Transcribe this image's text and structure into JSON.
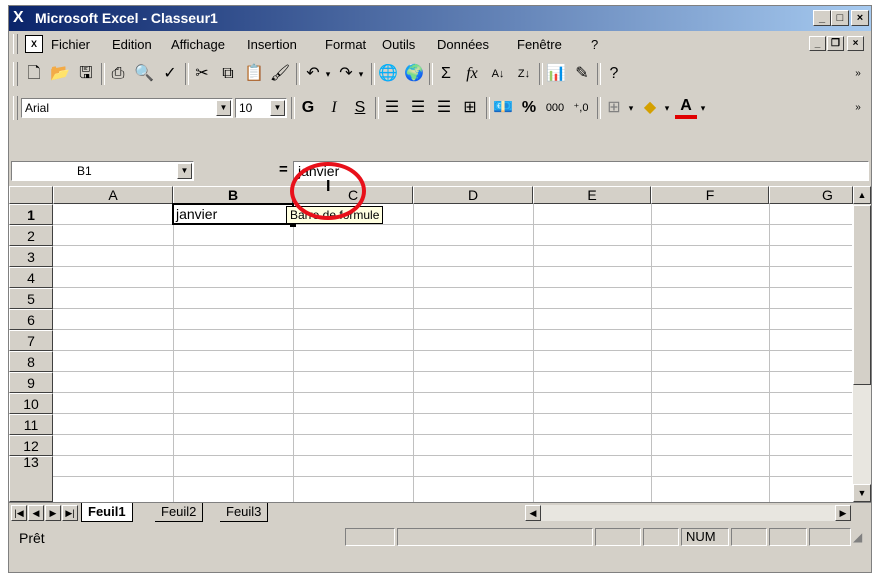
{
  "window": {
    "title": "Microsoft Excel - Classeur1",
    "app_icon": "excel-icon",
    "controls": [
      "minimize-icon",
      "maximize-icon",
      "close-icon"
    ]
  },
  "menubar": {
    "items": [
      "Fichier",
      "Edition",
      "Affichage",
      "Insertion",
      "Format",
      "Outils",
      "Données",
      "Fenêtre",
      "?"
    ]
  },
  "standard_toolbar": {
    "icons": [
      "new-icon",
      "open-icon",
      "save-icon",
      "print-icon",
      "print-preview-icon",
      "spelling-icon",
      "cut-icon",
      "copy-icon",
      "paste-icon",
      "format-painter-icon",
      "undo-icon",
      "redo-icon",
      "insert-hyperlink-icon",
      "web-toolbar-icon",
      "autosum-icon",
      "function-icon",
      "sort-ascending-icon",
      "sort-descending-icon",
      "chart-wizard-icon",
      "drawing-icon",
      "help-icon"
    ]
  },
  "formatting_toolbar": {
    "font": "Arial",
    "size": "10",
    "bold": "G",
    "italic": "I",
    "underline": "S",
    "percent": "%",
    "thousands": "000",
    "decimal": "⁺,0"
  },
  "formula_bar": {
    "name_box": "B1",
    "equals": "=",
    "value": "janvier"
  },
  "tooltip": "Barre de formule",
  "columns": [
    "A",
    "B",
    "C",
    "D",
    "E",
    "F",
    "G"
  ],
  "rows": [
    "1",
    "2",
    "3",
    "4",
    "5",
    "6",
    "7",
    "8",
    "9",
    "10",
    "11",
    "12",
    "13"
  ],
  "cells": {
    "B1": "janvier"
  },
  "active_cell": "B1",
  "sheets": [
    "Feuil1",
    "Feuil2",
    "Feuil3"
  ],
  "active_sheet": "Feuil1",
  "status": {
    "text": "Prêt",
    "num": "NUM"
  },
  "colors": {
    "annotation": "#e8101a",
    "title_start": "#0a246a",
    "title_end": "#a6caf0",
    "chrome": "#d4d0c8"
  }
}
